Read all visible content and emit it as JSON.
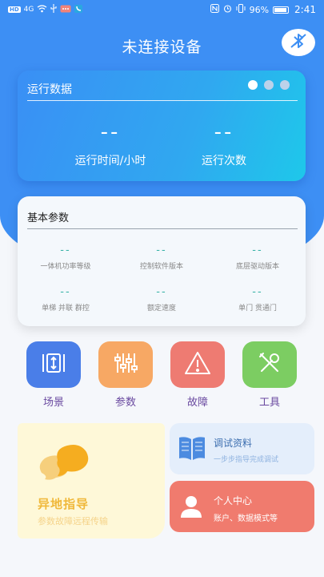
{
  "status_bar": {
    "left_chips": [
      "HD",
      "4G"
    ],
    "battery": "96%",
    "time": "2:41"
  },
  "header": {
    "title": "未连接设备"
  },
  "run_card": {
    "title": "运行数据",
    "metrics": [
      {
        "value": "--",
        "label": "运行时间/小时"
      },
      {
        "value": "--",
        "label": "运行次数"
      }
    ]
  },
  "basic_card": {
    "title": "基本参数",
    "params": [
      {
        "value": "--",
        "label": "一体机功率等级"
      },
      {
        "value": "--",
        "label": "控制软件版本"
      },
      {
        "value": "--",
        "label": "底层驱动版本"
      },
      {
        "value": "--",
        "label": "单梯 并联 群控"
      },
      {
        "value": "--",
        "label": "额定速度"
      },
      {
        "value": "--",
        "label": "单门 贯通门"
      }
    ]
  },
  "tiles": [
    {
      "label": "场景",
      "icon": "scene-icon",
      "color": "#4a7ee8"
    },
    {
      "label": "参数",
      "icon": "sliders-icon",
      "color": "#f7a864"
    },
    {
      "label": "故障",
      "icon": "warning-icon",
      "color": "#ee7b72"
    },
    {
      "label": "工具",
      "icon": "tools-icon",
      "color": "#7ccd62"
    }
  ],
  "remote_card": {
    "title": "异地指导",
    "subtitle": "参数故障远程传输"
  },
  "doc_card": {
    "title": "调试资料",
    "subtitle": "一步步指导完成调试"
  },
  "user_card": {
    "title": "个人中心",
    "subtitle": "账户、数据模式等"
  }
}
